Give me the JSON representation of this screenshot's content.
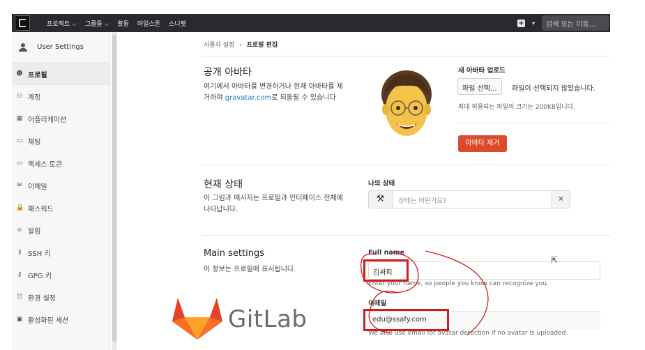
{
  "topnav": {
    "items": [
      "프로젝트 ⌵",
      "그룹들 ⌵",
      "활동",
      "마일스톤",
      "스니펫"
    ],
    "new_icon": "plus-square-icon",
    "search_placeholder": "검색 또는 이동..."
  },
  "sidebar": {
    "title": "User Settings",
    "items": [
      {
        "label": "프로필",
        "icon": "user-circle-icon",
        "glyph": "☻",
        "active": true
      },
      {
        "label": "계정",
        "icon": "account-icon",
        "glyph": "⚇",
        "active": false
      },
      {
        "label": "어플리케이션",
        "icon": "grid-icon",
        "glyph": "▦",
        "active": false
      },
      {
        "label": "채팅",
        "icon": "chat-icon",
        "glyph": "▭",
        "active": false
      },
      {
        "label": "액세스 토큰",
        "icon": "token-icon",
        "glyph": "▭",
        "active": false
      },
      {
        "label": "이메일",
        "icon": "mail-icon",
        "glyph": "✉",
        "active": false
      },
      {
        "label": "패스워드",
        "icon": "lock-icon",
        "glyph": "🔒",
        "active": false
      },
      {
        "label": "알림",
        "icon": "bell-icon",
        "glyph": "⍝",
        "active": false
      },
      {
        "label": "SSH 키",
        "icon": "key-icon",
        "glyph": "⚷",
        "active": false
      },
      {
        "label": "GPG 키",
        "icon": "key-icon",
        "glyph": "⚷",
        "active": false
      },
      {
        "label": "환경 설정",
        "icon": "preferences-icon",
        "glyph": "☷",
        "active": false
      },
      {
        "label": "활성화된 세션",
        "icon": "monitor-icon",
        "glyph": "▣",
        "active": false
      }
    ]
  },
  "breadcrumb": {
    "parent": "사용자 설정",
    "separator": "›",
    "current": "프로필 편집"
  },
  "avatar_section": {
    "title": "공개 아바타",
    "desc_line1": "여기에서 아바타를 변경하거나 현재 아바타를 제",
    "desc_line2_pre": "거하여 ",
    "desc_link": "gravatar.com",
    "desc_line2_post": "로 되돌릴 수 있습니다",
    "upload_label": "새 아바타 업로드",
    "choose_file": "파일 선택...",
    "no_file": "파일이 선택되지 않았습니다.",
    "max_size": "최대 허용되는 파일의 크기는 200KB입니다.",
    "remove_button": "아바타 제거"
  },
  "status_section": {
    "title": "현재 상태",
    "desc_line1": "이 그림과 메시지는 프로필과 인터페이스 전체에",
    "desc_line2": "나타납니다.",
    "label": "나의 상태",
    "emoji": "⚒",
    "placeholder": "상태는 어떤가요?",
    "clear": "×"
  },
  "main_settings": {
    "title": "Main settings",
    "desc": "이 정보는 프로필에 표시됩니다.",
    "fullname_label": "Full name",
    "fullname_value": "김싸피",
    "fullname_hint": "Enter your name, so people you know can recognize you.",
    "email_label": "이메일",
    "email_value": "edu@ssafy.com",
    "email_hint": "We also use email for avatar detection if no avatar is uploaded."
  },
  "watermark": {
    "text": "GitLab"
  },
  "colors": {
    "topnav": "#2a2a2e",
    "accent_red": "#dd4b2b",
    "annotation_red": "#d01c1c",
    "link": "#1f75cb"
  }
}
